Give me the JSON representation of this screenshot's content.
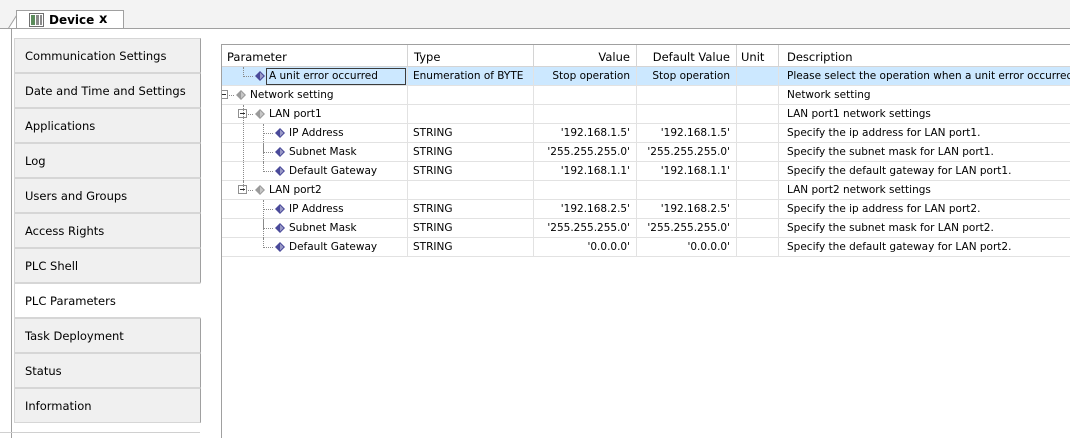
{
  "tab": {
    "label": "Device",
    "close": "x"
  },
  "sidebar": {
    "items": [
      {
        "label": "Communication Settings",
        "active": false
      },
      {
        "label": "Date and Time and Settings",
        "active": false
      },
      {
        "label": "Applications",
        "active": false
      },
      {
        "label": "Log",
        "active": false
      },
      {
        "label": "Users and Groups",
        "active": false
      },
      {
        "label": "Access Rights",
        "active": false
      },
      {
        "label": "PLC Shell",
        "active": false
      },
      {
        "label": "PLC Parameters",
        "active": true
      },
      {
        "label": "Task Deployment",
        "active": false
      },
      {
        "label": "Status",
        "active": false
      },
      {
        "label": "Information",
        "active": false
      }
    ]
  },
  "grid": {
    "columns": [
      "Parameter",
      "Type",
      "Value",
      "Default Value",
      "Unit",
      "Description"
    ],
    "rows": [
      {
        "parameter": "A unit error occurred",
        "type": "Enumeration of BYTE",
        "value": "Stop operation",
        "default": "Stop operation",
        "unit": "",
        "description": "Please select the operation when a unit error occurred.",
        "level": 1,
        "expander": false,
        "selected": true
      },
      {
        "parameter": "Network setting",
        "type": "",
        "value": "",
        "default": "",
        "unit": "",
        "description": "Network setting",
        "level": 0,
        "expander": true,
        "selected": false
      },
      {
        "parameter": "LAN port1",
        "type": "",
        "value": "",
        "default": "",
        "unit": "",
        "description": "LAN port1 network settings",
        "level": 1,
        "expander": true,
        "selected": false
      },
      {
        "parameter": "IP Address",
        "type": "STRING",
        "value": "'192.168.1.5'",
        "default": "'192.168.1.5'",
        "unit": "",
        "description": "Specify the ip address for LAN port1.",
        "level": 2,
        "expander": false,
        "selected": false
      },
      {
        "parameter": "Subnet Mask",
        "type": "STRING",
        "value": "'255.255.255.0'",
        "default": "'255.255.255.0'",
        "unit": "",
        "description": "Specify the subnet mask for LAN port1.",
        "level": 2,
        "expander": false,
        "selected": false
      },
      {
        "parameter": "Default Gateway",
        "type": "STRING",
        "value": "'192.168.1.1'",
        "default": "'192.168.1.1'",
        "unit": "",
        "description": "Specify the default gateway for LAN port1.",
        "level": 2,
        "expander": false,
        "selected": false
      },
      {
        "parameter": "LAN port2",
        "type": "",
        "value": "",
        "default": "",
        "unit": "",
        "description": "LAN port2 network settings",
        "level": 1,
        "expander": true,
        "selected": false
      },
      {
        "parameter": "IP Address",
        "type": "STRING",
        "value": "'192.168.2.5'",
        "default": "'192.168.2.5'",
        "unit": "",
        "description": "Specify the ip address for LAN port2.",
        "level": 2,
        "expander": false,
        "selected": false
      },
      {
        "parameter": "Subnet Mask",
        "type": "STRING",
        "value": "'255.255.255.0'",
        "default": "'255.255.255.0'",
        "unit": "",
        "description": "Specify the subnet mask for LAN port2.",
        "level": 2,
        "expander": false,
        "selected": false
      },
      {
        "parameter": "Default Gateway",
        "type": "STRING",
        "value": "'0.0.0.0'",
        "default": "'0.0.0.0'",
        "unit": "",
        "description": "Specify the default gateway for LAN port2.",
        "level": 2,
        "expander": false,
        "selected": false
      }
    ]
  },
  "colors": {
    "selection": "#cce8ff",
    "param_icon": "#4a4a9a"
  }
}
